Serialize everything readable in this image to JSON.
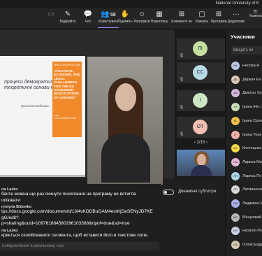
{
  "window": {
    "title": "National University of K"
  },
  "toolbar": {
    "timer": "",
    "items": [
      {
        "name": "video-off",
        "label": "",
        "icon": "▭",
        "disabled": true
      },
      {
        "name": "open",
        "label": "Відкрийте",
        "icon": "✎"
      },
      {
        "name": "chat",
        "label": "Чат",
        "icon": "💬"
      },
      {
        "name": "people",
        "label": "Користувачі",
        "icon": "👥",
        "count": "58"
      },
      {
        "name": "raise",
        "label": "Підніміть",
        "icon": "✋"
      },
      {
        "name": "react",
        "label": "Реагувати",
        "icon": "☺"
      },
      {
        "name": "view",
        "label": "Перегляну",
        "icon": "▦"
      },
      {
        "name": "apps",
        "label": "Елементи ке",
        "icon": "⊞"
      },
      {
        "name": "rooms",
        "label": "Кімната",
        "icon": "▢"
      },
      {
        "name": "programs",
        "label": "Програми",
        "icon": "⊞"
      },
      {
        "name": "more",
        "label": "Додатково",
        "icon": "···"
      }
    ],
    "camera_label": "Камера"
  },
  "slide": {
    "title": "процеси демократизації ах: теоретичні основи ідура",
    "author": "Кристіна Бебешко",
    "poster": {
      "header": "UNIA CONGRESS 2025",
      "body": "\"POLITICAL, ECONOMIC AND LEGAL CHALLENGES FOR THE EU ACCESSION NEGOTIATIONS OF UKRAINE\"",
      "city": "Lviv",
      "date": "23-24 October 2025"
    }
  },
  "tiles": [
    {
      "initials": "ЛІ",
      "color": "#c4e0a0"
    },
    {
      "initials": "СС",
      "color": "#b9dbe8"
    },
    {
      "initials": "І",
      "color": "#cfe6c5"
    },
    {
      "initials": "ОТ",
      "color": "#f3c0b3"
    }
  ],
  "pager": {
    "prev": "‹",
    "label": "2/15",
    "next": "›"
  },
  "chat": {
    "messages": [
      {
        "author": "na Lazko",
        "lines": [
          "бачте можна ще раз скинути посилання на програму не встигла",
          "опіювати"
        ]
      },
      {
        "author": "rystyna Bidonko",
        "lines": [
          "tps://docs.google.com/document/d/13i4vKODBuOAM4ersKjDeSENyJD7KE",
          "gG/edit?",
          "p=sharing&ouid=109761884580296103368&rtpof=true&sd=true"
        ]
      },
      {
        "author": "na Lazko",
        "lines": [
          "кряється скопійованого сегмента, щоб вставити його в текстове поле."
        ]
      }
    ],
    "input_placeholder": "повідомлення в реальному часі"
  },
  "captions": {
    "label": "Динамічні субтитри"
  },
  "participants": {
    "title": "Учасники",
    "invite_placeholder": "Введіть ім",
    "people": [
      {
        "initials": "НК",
        "name": "Несова Н",
        "color": "#b9c7e3"
      },
      {
        "initials": "ДЕ",
        "name": "Деркач Ел",
        "color": "#e0c7b6"
      },
      {
        "initials": "ДХ",
        "name": "Дмитро Хр",
        "color": "#d4b6e0"
      },
      {
        "initials": "ІН",
        "name": "Ірина (Не г",
        "color": "#c7e0b6"
      },
      {
        "initials": "ІЄ",
        "name": "Ірина Єрем",
        "color": "#f0c24a"
      },
      {
        "initials": "ІТ",
        "name": "Ірина Теле",
        "color": "#f0b0a8"
      },
      {
        "initials": "КС",
        "name": "Костецька",
        "color": "#f0d84a"
      },
      {
        "initials": "ЛМ",
        "name": "Лариса Ми",
        "color": "#e8b8d8"
      },
      {
        "initials": "ЛП",
        "name": "Лариса По",
        "color": "#a8d8e8"
      },
      {
        "initials": "ЛП",
        "name": "Литвиненко",
        "color": "#d8d8d8"
      },
      {
        "initials": "ЛМ",
        "name": "Людмила М",
        "color": "#a8b0e8"
      },
      {
        "initials": "МП",
        "name": "Мінцковий",
        "color": "#b8b8b8"
      },
      {
        "initials": "НР",
        "name": "Наталія Ро",
        "color": "#c8d0e8"
      },
      {
        "initials": "ОК",
        "name": "Олександр",
        "color": "#d8c8b0"
      }
    ]
  }
}
